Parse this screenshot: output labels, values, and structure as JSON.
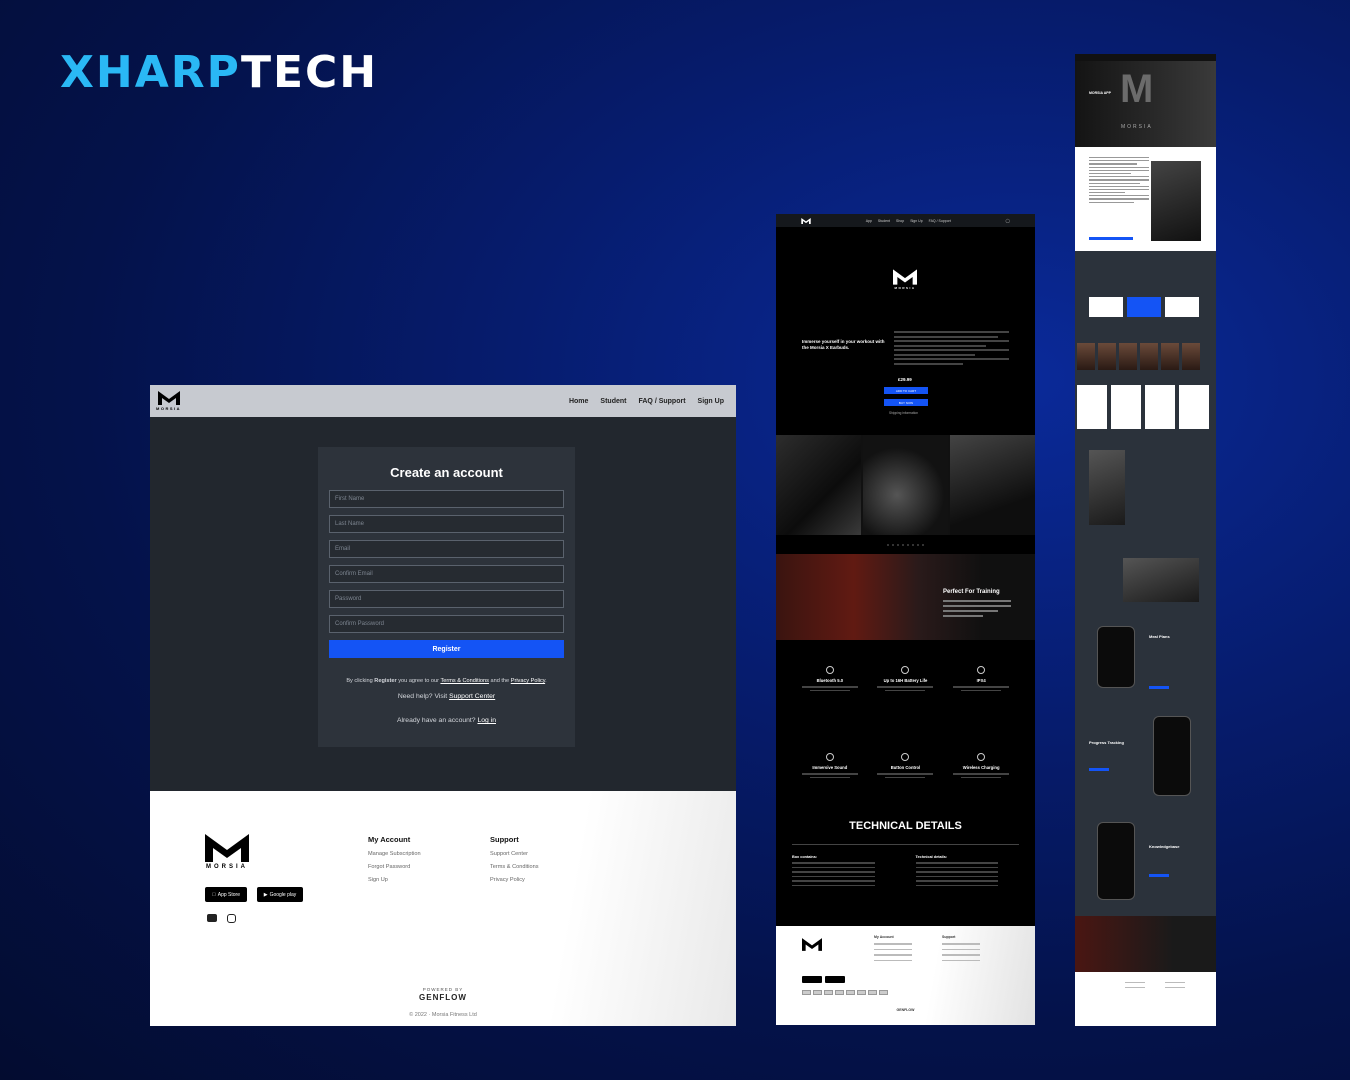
{
  "brand": {
    "part_a": "XHARP",
    "part_b": "TECH"
  },
  "panel1": {
    "nav": {
      "logo_word": "MORSIA",
      "links": [
        "Home",
        "Student",
        "FAQ / Support",
        "Sign Up"
      ]
    },
    "form": {
      "title": "Create an account",
      "fields": [
        "First Name",
        "Last Name",
        "Email",
        "Confirm Email",
        "Password",
        "Confirm Password"
      ],
      "submit": "Register",
      "terms_prefix": "By clicking ",
      "terms_register": "Register",
      "terms_mid": " you agree to our ",
      "terms_link": "Terms & Conditions",
      "terms_and": " and the ",
      "privacy_link": "Privacy Policy",
      "terms_end": ".",
      "help_prefix": "Need help? Visit ",
      "help_link": "Support Center",
      "login_prefix": "Already have an account? ",
      "login_link": "Log in"
    },
    "footer": {
      "logo_word": "MORSIA",
      "app_store": "App Store",
      "google_play": "Google play",
      "my_account": {
        "title": "My Account",
        "items": [
          "Manage Subscription",
          "Forgot Password",
          "Sign Up"
        ]
      },
      "support": {
        "title": "Support",
        "items": [
          "Support Center",
          "Terms & Conditions",
          "Privacy Policy"
        ]
      },
      "powered_by": "POWERED BY",
      "genflow": "GENFLOW",
      "copyright": "© 2022 · Morsia Fitness Ltd"
    }
  },
  "panel2": {
    "nav": {
      "links": [
        "App",
        "Student",
        "Shop",
        "Sign Up",
        "FAQ / Support"
      ]
    },
    "hero": {
      "logo_word": "MORSIA",
      "headline": "Immerse yourself in your workout with the Morsia X Earbuds.",
      "price": "£29.99",
      "add_to_cart": "ADD TO CART",
      "buy_now": "BUY NOW",
      "shipping": "Shipping information"
    },
    "band": {
      "title": "Perfect For Training"
    },
    "features": [
      "Bluetooth 5.0",
      "Up to 16H Battery Life",
      "IPX4",
      "Immersive Sound",
      "Button Control",
      "Wireless Charging"
    ],
    "tech": {
      "title": "TECHNICAL DETAILS",
      "box": "Box contains:",
      "details": "Technical details:"
    },
    "footer": {
      "my_account": "My Account",
      "support": "Support",
      "genflow": "GENFLOW"
    }
  },
  "panel3": {
    "hero": {
      "title": "MORSIA APP",
      "wordmark": "MORSIA"
    },
    "sections": {
      "meal": "Meal Plans",
      "progress": "Progress Tracking",
      "knowledge": "Knowledgebase"
    }
  },
  "colors": {
    "accent": "#1454f5",
    "brand_cyan": "#2ab8f5",
    "dark_bg": "#22272e"
  }
}
